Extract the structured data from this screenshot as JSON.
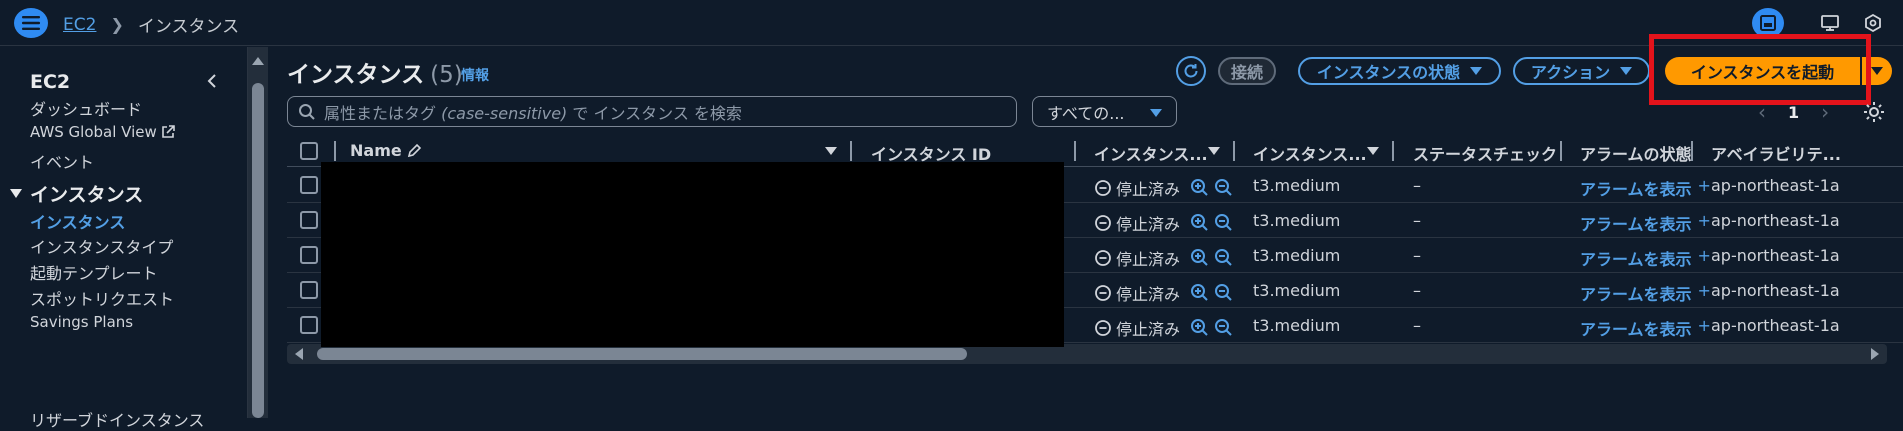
{
  "topbar": {
    "breadcrumb_root": "EC2",
    "breadcrumb_current": "インスタンス"
  },
  "sidebar": {
    "title": "EC2",
    "items": [
      {
        "label": "ダッシュボード"
      },
      {
        "label": "AWS Global View"
      },
      {
        "label": "イベント"
      }
    ],
    "section": "インスタンス",
    "section_items": [
      {
        "label": "インスタンス",
        "active": true
      },
      {
        "label": "インスタンスタイプ"
      },
      {
        "label": "起動テンプレート"
      },
      {
        "label": "スポットリクエスト"
      },
      {
        "label": "Savings Plans"
      },
      {
        "label": "リザーブドインスタンス"
      }
    ]
  },
  "header": {
    "title": "インスタンス",
    "count": "(5)",
    "info": "情報"
  },
  "actions": {
    "connect": "接続",
    "instance_state": "インスタンスの状態",
    "actions": "アクション",
    "launch": "インスタンスを起動"
  },
  "search": {
    "placeholder_prefix": "属性またはタグ",
    "placeholder_italic": "(case-sensitive)",
    "placeholder_suffix": "で インスタンス を検索"
  },
  "filter": {
    "selected": "すべての..."
  },
  "pagination": {
    "page": "1"
  },
  "table": {
    "columns": [
      "Name",
      "インスタンス ID",
      "インスタンス...",
      "インスタンス...",
      "ステータスチェック",
      "アラームの状態",
      "アベイラビリテ..."
    ],
    "rows": [
      {
        "state": "停止済み",
        "type": "t3.medium",
        "status_check": "–",
        "alarm": "アラームを表示",
        "az": "ap-northeast-1a"
      },
      {
        "state": "停止済み",
        "type": "t3.medium",
        "status_check": "–",
        "alarm": "アラームを表示",
        "az": "ap-northeast-1a"
      },
      {
        "state": "停止済み",
        "type": "t3.medium",
        "status_check": "–",
        "alarm": "アラームを表示",
        "az": "ap-northeast-1a"
      },
      {
        "state": "停止済み",
        "type": "t3.medium",
        "status_check": "–",
        "alarm": "アラームを表示",
        "az": "ap-northeast-1a"
      },
      {
        "state": "停止済み",
        "type": "t3.medium",
        "status_check": "–",
        "alarm": "アラームを表示",
        "az": "ap-northeast-1a"
      }
    ]
  },
  "colors": {
    "background": "#0f1b2a",
    "link": "#539fe5",
    "primary": "#ff9900",
    "highlight": "#e3131b"
  }
}
